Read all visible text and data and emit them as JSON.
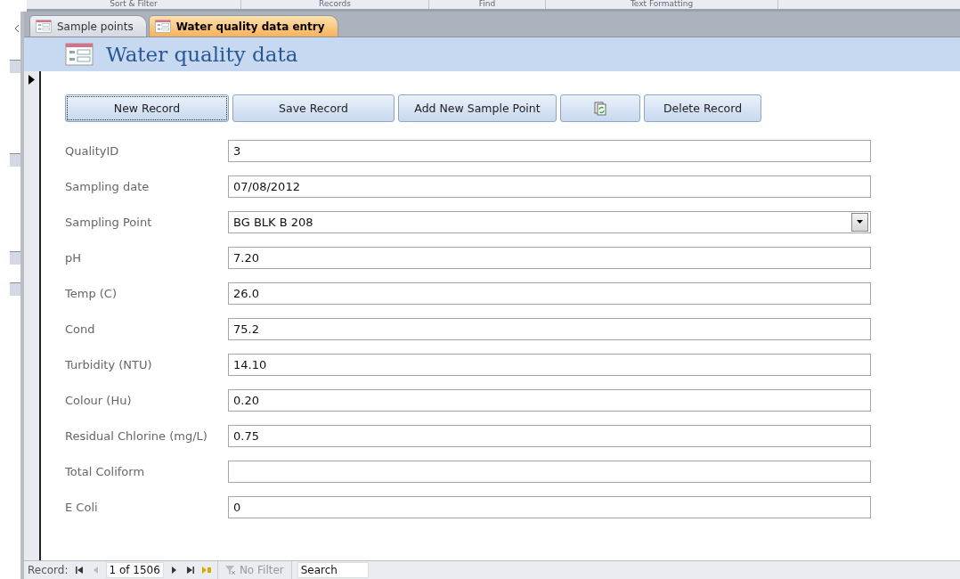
{
  "ribbon_groups": [
    "Sort & Filter",
    "Records",
    "Find",
    "Text Formatting"
  ],
  "tabs": [
    {
      "label": "Sample points",
      "selected": false
    },
    {
      "label": "Water quality data entry",
      "selected": true
    }
  ],
  "form": {
    "title": "Water quality data",
    "buttons": [
      {
        "kind": "text",
        "label": "New Record",
        "focused": true
      },
      {
        "kind": "text",
        "label": "Save Record",
        "focused": false
      },
      {
        "kind": "text",
        "label": "Add New Sample Point",
        "focused": false
      },
      {
        "kind": "icon",
        "focused": false
      },
      {
        "kind": "text",
        "label": "Delete Record",
        "focused": false
      }
    ],
    "fields": [
      {
        "kind": "text",
        "label": "QualityID",
        "value": "3"
      },
      {
        "kind": "text",
        "label": "Sampling date",
        "value": "07/08/2012"
      },
      {
        "kind": "combo",
        "label": "Sampling Point",
        "value": "BG BLK B 208"
      },
      {
        "kind": "text",
        "label": "pH",
        "value": "7.20"
      },
      {
        "kind": "text",
        "label": "Temp (C)",
        "value": "26.0"
      },
      {
        "kind": "text",
        "label": "Cond",
        "value": "75.2"
      },
      {
        "kind": "text",
        "label": "Turbidity (NTU)",
        "value": "14.10"
      },
      {
        "kind": "text",
        "label": "Colour (Hu)",
        "value": "0.20"
      },
      {
        "kind": "text",
        "label": "Residual Chlorine (mg/L)",
        "value": "0.75"
      },
      {
        "kind": "text",
        "label": "Total Coliform"
      },
      {
        "kind": "text",
        "label": "E Coli",
        "value": "0"
      }
    ]
  },
  "status_bar": {
    "label": "Record:",
    "position": "1 of 1506",
    "filter": "No Filter",
    "search": {
      "placeholder": "Search"
    }
  }
}
